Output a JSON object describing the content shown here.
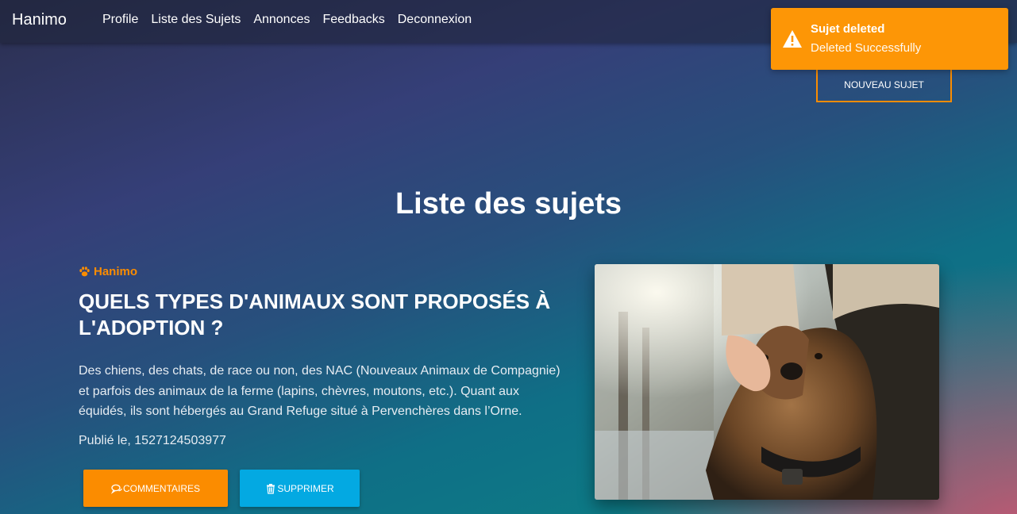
{
  "navbar": {
    "brand": "Hanimo",
    "links": [
      "Profile",
      "Liste des Sujets",
      "Annonces",
      "Feedbacks",
      "Deconnexion"
    ]
  },
  "toast": {
    "title": "Sujet deleted",
    "message": "Deleted Successfully",
    "icon": "warning-icon",
    "color": "#fd9606"
  },
  "new_subject_button": "NOUVEAU SUJET",
  "page_title": "Liste des sujets",
  "post": {
    "category": "Hanimo",
    "category_icon": "paw-icon",
    "title": "QUELS TYPES D'ANIMAUX SONT PROPOSÉS À L'ADOPTION ?",
    "description": "Des chiens, des chats, de race ou non, des NAC (Nouveaux Animaux de Compagnie) et parfois des animaux de la ferme (lapins, chèvres, moutons, etc.). Quant aux équidés, ils sont hébergés au Grand Refuge situé à Pervenchères dans l’Orne.",
    "published": "Publié le, 1527124503977",
    "buttons": {
      "comments": "COMMENTAIRES",
      "delete": "SUPPRIMER"
    }
  },
  "colors": {
    "accent_orange": "#fb8c00",
    "accent_blue": "#03a9e2"
  }
}
